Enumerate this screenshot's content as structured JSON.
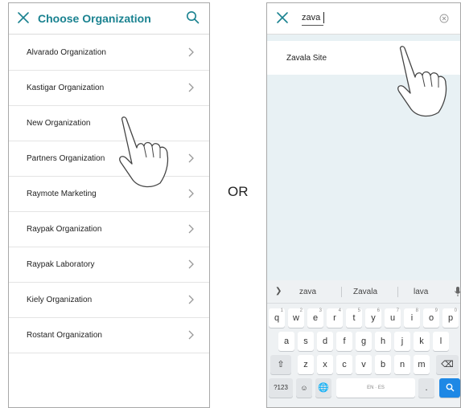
{
  "left": {
    "title": "Choose Organization",
    "icons": {
      "close": "close-icon",
      "search": "search-icon",
      "chevron": "chevron-right-icon"
    },
    "items": [
      {
        "label": "Alvarado Organization",
        "chevron": true
      },
      {
        "label": "Kastigar  Organization",
        "chevron": true
      },
      {
        "label": "New Organization",
        "chevron": false
      },
      {
        "label": "Partners Organization",
        "chevron": true
      },
      {
        "label": "Raymote Marketing",
        "chevron": true
      },
      {
        "label": "Raypak  Organization",
        "chevron": true
      },
      {
        "label": "Raypak Laboratory",
        "chevron": true
      },
      {
        "label": "Kiely  Organization",
        "chevron": true
      },
      {
        "label": "Rostant  Organization",
        "chevron": true
      }
    ]
  },
  "separator": {
    "label": "OR"
  },
  "right": {
    "search": {
      "value": "zava"
    },
    "results": [
      {
        "label": "Zavala Site"
      }
    ],
    "keyboard": {
      "suggestions": [
        "zava",
        "Zavala",
        "lava"
      ],
      "row1": [
        {
          "k": "q",
          "h": "1"
        },
        {
          "k": "w",
          "h": "2"
        },
        {
          "k": "e",
          "h": "3"
        },
        {
          "k": "r",
          "h": "4"
        },
        {
          "k": "t",
          "h": "5"
        },
        {
          "k": "y",
          "h": "6"
        },
        {
          "k": "u",
          "h": "7"
        },
        {
          "k": "i",
          "h": "8"
        },
        {
          "k": "o",
          "h": "9"
        },
        {
          "k": "p",
          "h": "0"
        }
      ],
      "row2": [
        "a",
        "s",
        "d",
        "f",
        "g",
        "h",
        "j",
        "k",
        "l"
      ],
      "row3": [
        "z",
        "x",
        "c",
        "v",
        "b",
        "n",
        "m"
      ],
      "numbers_label": "?123",
      "language_label": "EN · ES",
      "period_label": "."
    }
  },
  "colors": {
    "accent": "#1a8290",
    "keyboard_bg": "#eef1f3",
    "results_bg": "#e8f1f4",
    "go_key": "#1e88e5"
  }
}
